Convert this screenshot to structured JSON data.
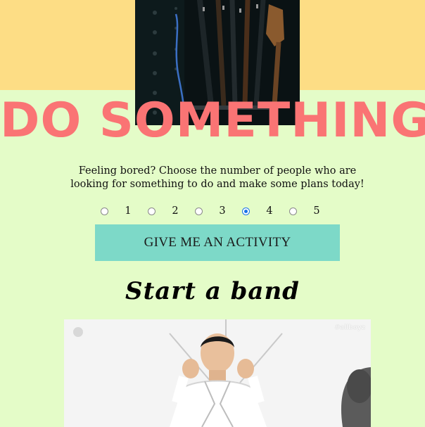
{
  "header": {
    "title": "DO SOMETHING",
    "background_color": "#fddd85",
    "title_color": "#fa7474",
    "hero_image": "guitars-on-stand-photo"
  },
  "intro": {
    "text": "Feeling bored? Choose the number of people who are looking for something to do and make some plans today!"
  },
  "people_options": {
    "options": [
      "1",
      "2",
      "3",
      "4",
      "5"
    ],
    "selected": "4"
  },
  "activity_button": {
    "label": "GIVE ME AN ACTIVITY",
    "color": "#7dd9c8"
  },
  "activity": {
    "title": "Start a band",
    "gif": "man-in-white-suit-gif",
    "watermark": "#allboyz"
  },
  "page": {
    "background_color": "#e4fcc8"
  }
}
